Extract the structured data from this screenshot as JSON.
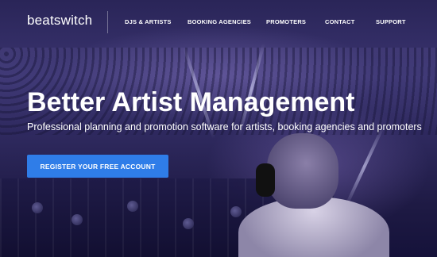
{
  "brand": {
    "logo_text": "beatswitch"
  },
  "nav": {
    "items": [
      {
        "label": "DJS & ARTISTS"
      },
      {
        "label": "BOOKING AGENCIES"
      },
      {
        "label": "PROMOTERS"
      },
      {
        "label": "CONTACT"
      },
      {
        "label": "SUPPORT"
      }
    ]
  },
  "hero": {
    "headline": "Better Artist Management",
    "subheadline": "Professional planning and promotion software for artists, booking agencies and promoters",
    "cta_label": "REGISTER YOUR FREE ACCOUNT",
    "background_image": "concert-crowd-with-dj"
  },
  "colors": {
    "cta": "#2f7de8",
    "text": "#ffffff",
    "overlay": "#2a2558"
  }
}
